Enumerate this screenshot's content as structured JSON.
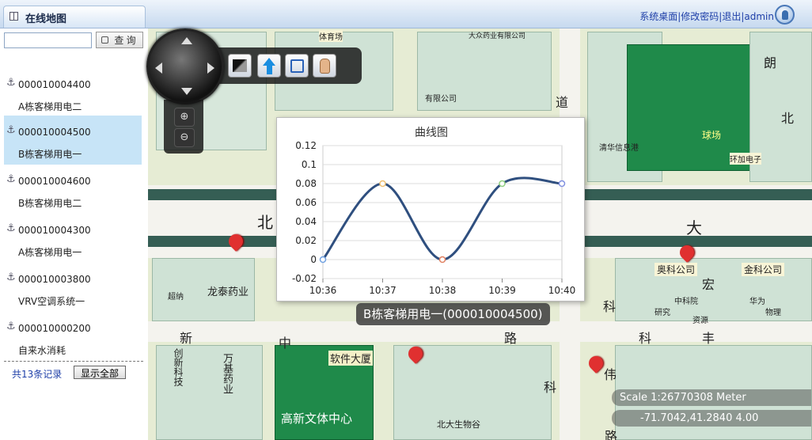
{
  "header": {
    "title": "在线地图",
    "links": [
      "系统桌面",
      "修改密码",
      "退出",
      "admin"
    ],
    "separator": "|"
  },
  "search": {
    "placeholder": "",
    "button_label": "查 询"
  },
  "list": {
    "items": [
      {
        "code": "000010004400",
        "name": "A栋客梯用电二"
      },
      {
        "code": "000010004500",
        "name": "B栋客梯用电一"
      },
      {
        "code": "000010004600",
        "name": "B栋客梯用电二"
      },
      {
        "code": "000010004300",
        "name": "A栋客梯用电一"
      },
      {
        "code": "000010003800",
        "name": "VRV空调系统一"
      },
      {
        "code": "000010000200",
        "name": "自来水消耗"
      }
    ],
    "selected_index": 1,
    "record_count": "共13条记录",
    "show_all_label": "显示全部"
  },
  "map": {
    "labels": [
      "北",
      "大",
      "科",
      "丰",
      "路",
      "新",
      "中",
      "龙泰药业",
      "软件大厦",
      "高新文体中心",
      "北大生物谷",
      "万基药业",
      "创新科技",
      "伟",
      "科",
      "奥科公司",
      "金科公司",
      "球场",
      "朗",
      "道",
      "清华信息港",
      "环加电子",
      "有限公司",
      "大众药业有限公司",
      "中科院",
      "华为",
      "体育场",
      "路",
      "北",
      "资源",
      "科",
      "宏",
      "研究",
      "物理",
      "超纳"
    ]
  },
  "popup": {
    "label": "B栋客梯用电一(000010004500)"
  },
  "status": {
    "scale_text": "Scale    1:26770308 Meter",
    "coords_text": "-71.7042,41.2840      4.00"
  },
  "chart_data": {
    "type": "line",
    "title": "曲线图",
    "categories": [
      "10:36",
      "10:37",
      "10:38",
      "10:39",
      "10:40"
    ],
    "series": [
      {
        "values": [
          0,
          0.08,
          0,
          0.08,
          0.08
        ]
      }
    ],
    "ylim": [
      -0.02,
      0.12
    ],
    "yticks": [
      -0.02,
      0,
      0.02,
      0.04,
      0.06,
      0.08,
      0.1,
      0.12
    ],
    "ytick_labels": [
      "-0.02",
      "0",
      "0.02",
      "0.04",
      "0.06",
      "0.08",
      "0.1",
      "0.12"
    ],
    "grid": true,
    "line_color": "#2f4f7f"
  }
}
